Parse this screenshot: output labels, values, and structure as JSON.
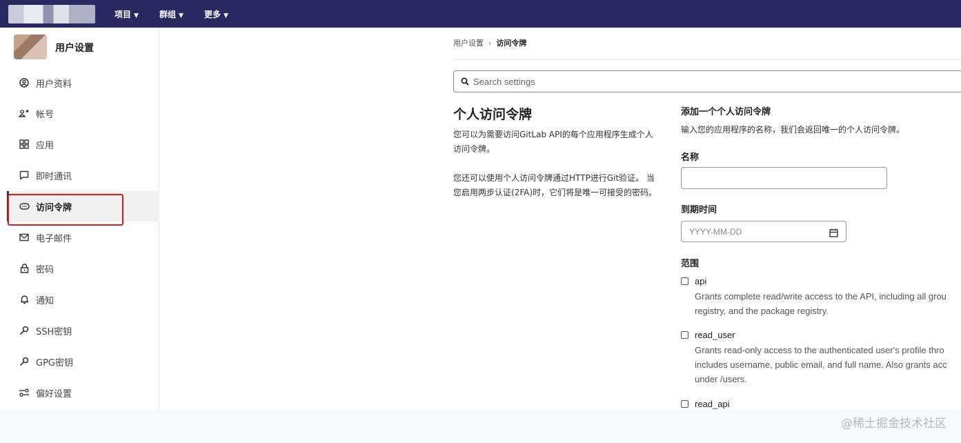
{
  "nav": {
    "items": [
      {
        "label": "项目"
      },
      {
        "label": "群组"
      },
      {
        "label": "更多"
      }
    ]
  },
  "sidebar": {
    "title": "用户设置",
    "items": [
      {
        "label": "用户资料",
        "icon": "user-circle-icon"
      },
      {
        "label": "帐号",
        "icon": "account-icon"
      },
      {
        "label": "应用",
        "icon": "applications-icon"
      },
      {
        "label": "即时通讯",
        "icon": "chat-icon"
      },
      {
        "label": "访问令牌",
        "icon": "token-icon",
        "active": true
      },
      {
        "label": "电子邮件",
        "icon": "mail-icon"
      },
      {
        "label": "密码",
        "icon": "lock-icon"
      },
      {
        "label": "通知",
        "icon": "bell-icon"
      },
      {
        "label": "SSH密钥",
        "icon": "key-icon"
      },
      {
        "label": "GPG密钥",
        "icon": "key-icon"
      },
      {
        "label": "偏好设置",
        "icon": "preferences-icon"
      }
    ]
  },
  "breadcrumb": {
    "parent": "用户设置",
    "separator": "›",
    "current": "访问令牌"
  },
  "search": {
    "placeholder": "Search settings"
  },
  "section": {
    "title": "个人访问令牌",
    "desc1": "您可以为需要访问GitLab API的每个应用程序生成个人访问令牌。",
    "desc2": "您还可以使用个人访问令牌通过HTTP进行Git验证。 当您启用两步认证(2FA)时，它们将是唯一可接受的密码。"
  },
  "form": {
    "title": "添加一个个人访问令牌",
    "subtitle": "输入您的应用程序的名称，我们会返回唯一的个人访问令牌。",
    "name_label": "名称",
    "expiry_label": "到期时间",
    "expiry_placeholder": "YYYY-MM-DD",
    "scopes_label": "范围",
    "scopes": [
      {
        "name": "api",
        "lines": [
          "Grants complete read/write access to the API, including all grou",
          "registry, and the package registry."
        ]
      },
      {
        "name": "read_user",
        "lines": [
          "Grants read-only access to the authenticated user's profile thro",
          "includes username, public email, and full name. Also grants acc",
          "under /users."
        ]
      },
      {
        "name": "read_api",
        "lines": []
      }
    ]
  },
  "watermark": "@稀土掘金技术社区",
  "colors": {
    "topbar": "#292961",
    "highlight": "#e0181a"
  }
}
